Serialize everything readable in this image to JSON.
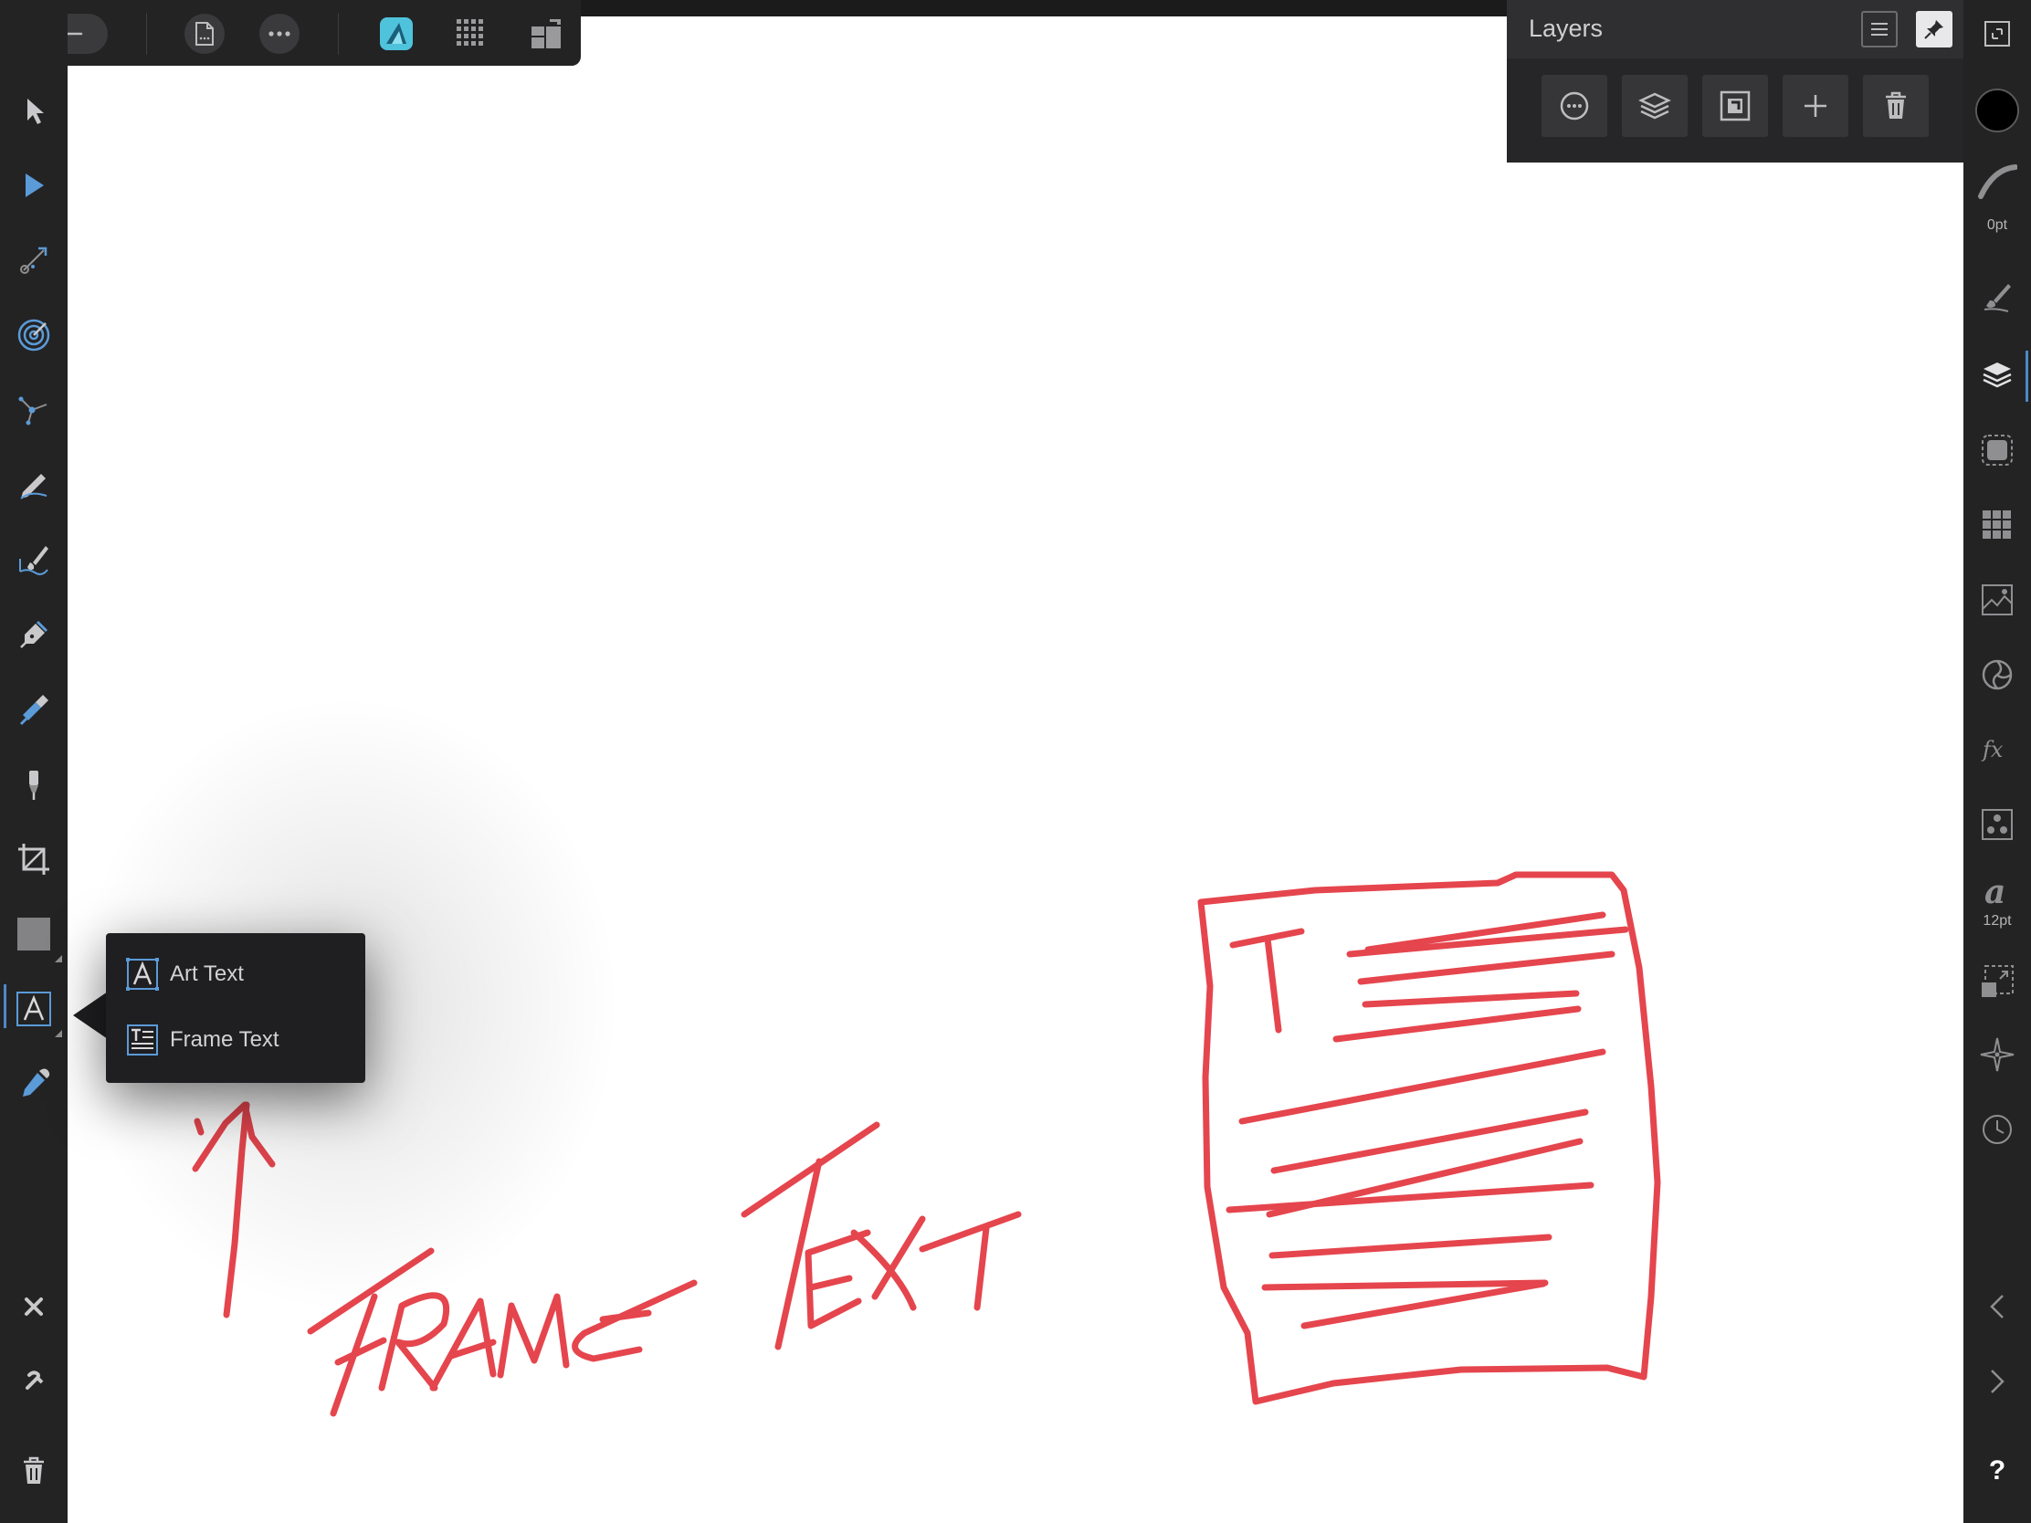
{
  "app": {
    "accent_color": "#4d88c9",
    "sketch_color": "#e5454d"
  },
  "top_toolbar": {
    "buttons": [
      "back-arrow-icon",
      "document-icon",
      "more-icon",
      "persona-designer-icon",
      "pixel-persona-icon",
      "export-persona-icon"
    ]
  },
  "left_toolbar": {
    "tools": [
      "move-tool",
      "node-tool",
      "contour-tool",
      "corner-tool",
      "point-transform-tool",
      "pencil-tool",
      "vector-brush-tool",
      "pen-tool",
      "fill-tool",
      "transparency-tool",
      "crop-tool",
      "rectangle-tool",
      "text-tool",
      "color-picker-tool"
    ],
    "bottom": [
      "close-icon",
      "snapping-magnet-icon",
      "trash-icon"
    ]
  },
  "text_tool_flyout": {
    "items": [
      {
        "label": "Art Text",
        "icon": "art-text-icon"
      },
      {
        "label": "Frame Text",
        "icon": "frame-text-icon"
      }
    ]
  },
  "layers_panel": {
    "title": "Layers",
    "actions": [
      "layer-options-icon",
      "layer-stack-icon",
      "mask-icon",
      "add-layer-icon",
      "delete-layer-icon"
    ]
  },
  "right_studio": {
    "stroke_width_label": "0pt",
    "font_size_label": "12pt",
    "help_label": "?",
    "fill_color": "#000000"
  },
  "sketch": {
    "annotation_text": "FRAME TEXT"
  }
}
